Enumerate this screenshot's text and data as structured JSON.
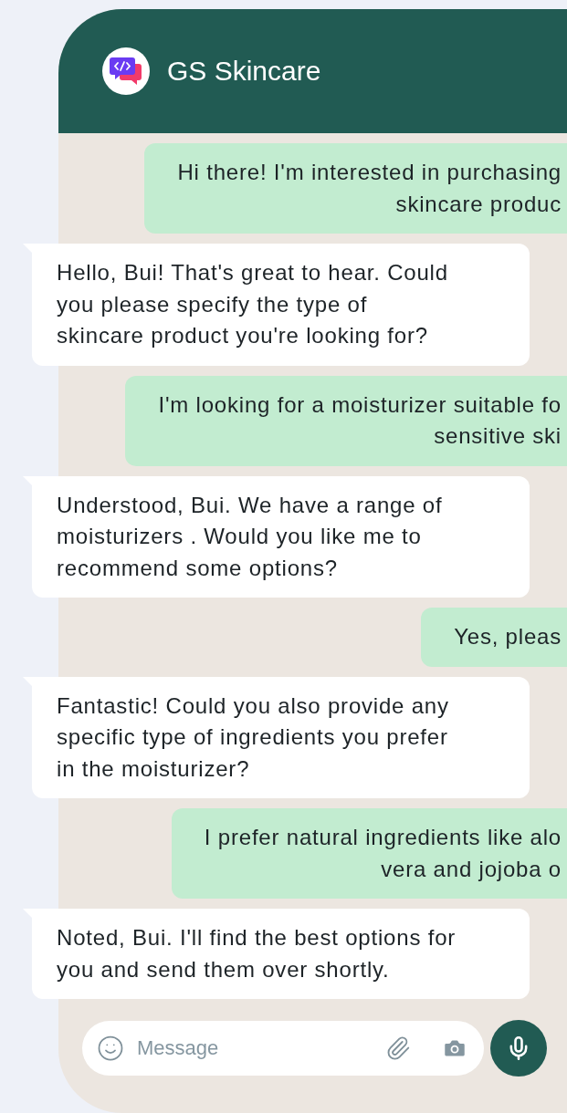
{
  "header": {
    "title": "GS Skincare"
  },
  "messages": [
    {
      "kind": "outgoing",
      "text": "Hi there! I'm interested in purchasing\nskincare produc"
    },
    {
      "kind": "incoming",
      "text": "Hello, Bui! That's great to hear. Could\nyou please specify the type of\nskincare product you're looking for?"
    },
    {
      "kind": "outgoing",
      "text": "I'm looking for a moisturizer suitable fo\nsensitive ski"
    },
    {
      "kind": "incoming",
      "text": "Understood, Bui. We have a range of\nmoisturizers . Would you like me to\nrecommend some options?"
    },
    {
      "kind": "outgoing",
      "text": "Yes, pleas"
    },
    {
      "kind": "incoming",
      "text": "Fantastic! Could you also provide any\nspecific type of ingredients you prefer\nin the moisturizer?"
    },
    {
      "kind": "outgoing",
      "text": "I prefer natural ingredients like alo\nvera and jojoba o"
    },
    {
      "kind": "incoming",
      "text": "Noted, Bui. I'll find the best options for\nyou and send them over shortly."
    }
  ],
  "composer": {
    "placeholder": "Message"
  }
}
